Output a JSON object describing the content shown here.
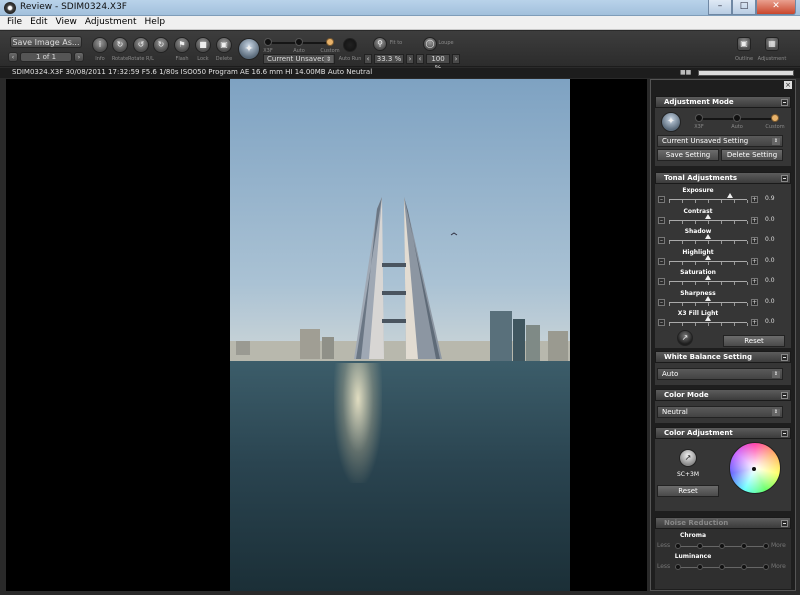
{
  "window": {
    "title": "Review - SDIM0324.X3F"
  },
  "menu": {
    "items": [
      "File",
      "Edit",
      "View",
      "Adjustment",
      "Help"
    ]
  },
  "toolbar": {
    "save_image_as": "Save Image As...",
    "page": "1 of 1",
    "tools": [
      "Info",
      "Rotate",
      "Rotate R/L",
      "Flash",
      "Lock",
      "Delete"
    ],
    "mode_labels": [
      "X3F",
      "Auto",
      "Custom"
    ],
    "setting_combo": "Current Unsaved...",
    "auto_run": "Auto Run",
    "fit_label": "Fit to",
    "zoom": "33.3 %",
    "loupe_label": "Loupe",
    "loupe_zoom": "100 %",
    "right_tools": [
      "Outline",
      "Adjustment"
    ]
  },
  "infobar": {
    "text": "SDIM0324.X3F 30/08/2011 17:32:59 F5.6 1/80s ISO050 Program AE 16.6 mm HI 14.00MB Auto Neutral"
  },
  "panel": {
    "adjustment_mode": {
      "title": "Adjustment Mode",
      "labels": [
        "X3F",
        "Auto",
        "Custom"
      ],
      "setting": "Current Unsaved Setting",
      "save": "Save Setting",
      "delete": "Delete Setting"
    },
    "tonal": {
      "title": "Tonal Adjustments",
      "sliders": [
        {
          "label": "Exposure",
          "value": "0.9",
          "position": 0.78
        },
        {
          "label": "Contrast",
          "value": "0.0",
          "position": 0.5
        },
        {
          "label": "Shadow",
          "value": "0.0",
          "position": 0.5
        },
        {
          "label": "Highlight",
          "value": "0.0",
          "position": 0.5
        },
        {
          "label": "Saturation",
          "value": "0.0",
          "position": 0.5
        },
        {
          "label": "Sharpness",
          "value": "0.0",
          "position": 0.5
        },
        {
          "label": "X3 Fill Light",
          "value": "0.0",
          "position": 0.5
        }
      ],
      "reset": "Reset"
    },
    "white_balance": {
      "title": "White Balance Setting",
      "value": "Auto"
    },
    "color_mode": {
      "title": "Color Mode",
      "value": "Neutral"
    },
    "color_adjustment": {
      "title": "Color Adjustment",
      "label": "SC+3M",
      "reset": "Reset"
    },
    "noise_reduction": {
      "title": "Noise Reduction",
      "rows": [
        {
          "label": "Chroma",
          "left": "Less",
          "right": "More"
        },
        {
          "label": "Luminance",
          "left": "Less",
          "right": "More"
        }
      ]
    }
  }
}
